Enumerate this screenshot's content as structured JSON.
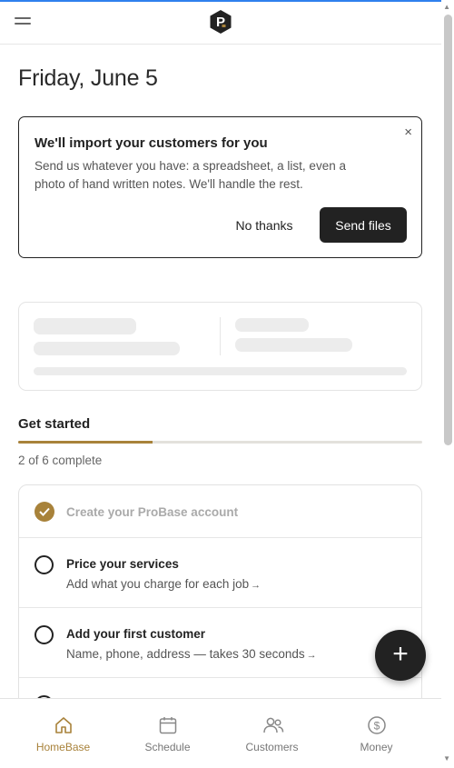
{
  "header": {
    "menu_icon": "hamburger-menu-icon",
    "logo_icon": "probase-logo-icon",
    "logo_letter": "P"
  },
  "date": "Friday, June 5",
  "import_card": {
    "title": "We'll import your customers for you",
    "description": "Send us whatever you have: a spreadsheet, a list, even a photo of hand written notes. We'll handle the rest.",
    "close_icon": "close-icon",
    "close_glyph": "×",
    "dismiss_label": "No thanks",
    "send_label": "Send files"
  },
  "get_started": {
    "title": "Get started",
    "completed": 2,
    "total": 6,
    "count_text": "2 of 6 complete",
    "tasks": [
      {
        "title": "Create your ProBase account",
        "done": true
      },
      {
        "title": "Price your services",
        "subtitle": "Add what you charge for each job",
        "arrow": "→",
        "done": false
      },
      {
        "title": "Add your first customer",
        "subtitle": "Name, phone, address — takes 30 seconds",
        "arrow": "→",
        "done": false
      }
    ]
  },
  "fab": {
    "icon": "plus-icon",
    "glyph": "+"
  },
  "bottom_nav": [
    {
      "label": "HomeBase",
      "icon": "home-icon",
      "active": true
    },
    {
      "label": "Schedule",
      "icon": "calendar-icon",
      "active": false
    },
    {
      "label": "Customers",
      "icon": "users-icon",
      "active": false
    },
    {
      "label": "Money",
      "icon": "dollar-icon",
      "active": false
    }
  ],
  "colors": {
    "accent": "#a8823a",
    "dark": "#222222",
    "top_bar": "#2f80ed"
  }
}
